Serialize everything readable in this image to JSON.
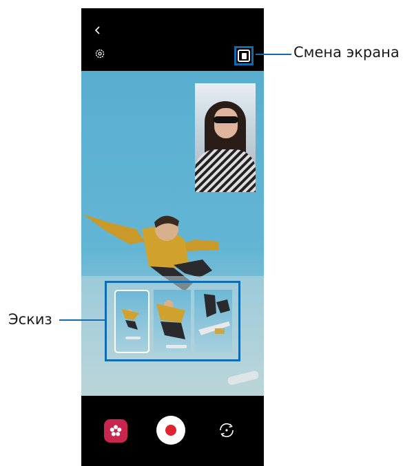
{
  "callouts": {
    "screen_switch": "Смена экрана",
    "thumbnail": "Эскиз"
  },
  "icons": {
    "back": "chevron-left-icon",
    "settings": "gear-icon",
    "switch_screen": "switch-screen-icon",
    "effects": "flower-effects-icon",
    "record": "record-icon",
    "flip_camera": "flip-camera-icon"
  },
  "colors": {
    "callout": "#0f6cb0",
    "record": "#e0242f",
    "effects": "#c8264e"
  },
  "thumbnails": {
    "count": 3,
    "selected_index": 0
  }
}
